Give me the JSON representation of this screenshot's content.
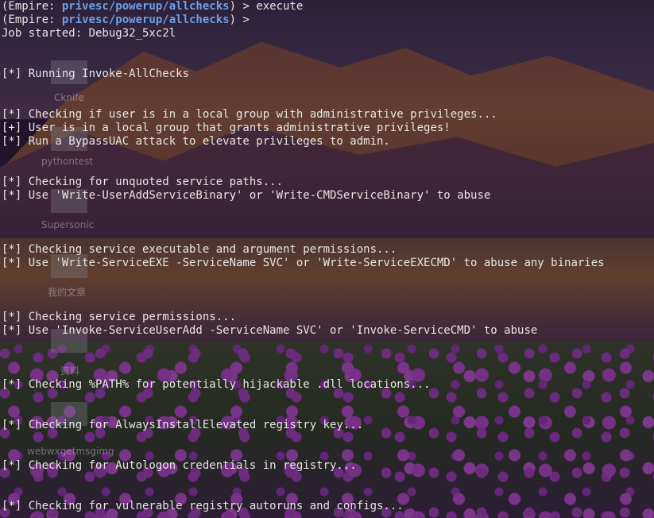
{
  "background": {
    "desktop_icons": [
      {
        "label": "Cknife"
      },
      {
        "label": "pythontest"
      },
      {
        "label": "Supersonic"
      },
      {
        "label": "我的文章"
      },
      {
        "label": "资料"
      },
      {
        "label": "webwxgetmsgimg"
      }
    ]
  },
  "terminal": {
    "colors": {
      "text": "#e8e6e3",
      "prompt_path": "#6f9fe6"
    },
    "prompt1": {
      "open": "(Empire: ",
      "path": "privesc/powerup/allchecks",
      "close": ") > execute"
    },
    "prompt2": {
      "open": "(Empire: ",
      "path": "privesc/powerup/allchecks",
      "close": ") > "
    },
    "lines": {
      "job": "Job started: Debug32_5xc2l",
      "l1": "[*] Running Invoke-AllChecks",
      "l2": "[*] Checking if user is in a local group with administrative privileges...",
      "l3": "[+] User is in a local group that grants administrative privileges!",
      "l4": "[*] Run a BypassUAC attack to elevate privileges to admin.",
      "l5": "[*] Checking for unquoted service paths...",
      "l6": "[*] Use 'Write-UserAddServiceBinary' or 'Write-CMDServiceBinary' to abuse",
      "l7": "[*] Checking service executable and argument permissions...",
      "l8": "[*] Use 'Write-ServiceEXE -ServiceName SVC' or 'Write-ServiceEXECMD' to abuse any binaries",
      "l9": "[*] Checking service permissions...",
      "l10": "[*] Use 'Invoke-ServiceUserAdd -ServiceName SVC' or 'Invoke-ServiceCMD' to abuse",
      "l11": "[*] Checking %PATH% for potentially hijackable .dll locations...",
      "l12": "[*] Checking for AlwaysInstallElevated registry key...",
      "l13": "[*] Checking for Autologon credentials in registry...",
      "l14": "[*] Checking for vulnerable registry autoruns and configs..."
    }
  }
}
